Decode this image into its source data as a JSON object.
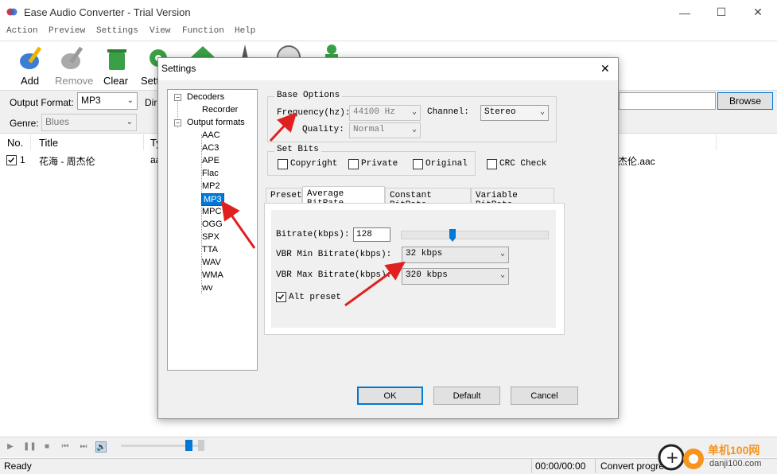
{
  "window": {
    "title": "Ease Audio Converter - Trial Version",
    "minimize": "—",
    "maximize": "☐",
    "close": "✕"
  },
  "menu": [
    "Action",
    "Preview",
    "Settings",
    "View",
    "Function",
    "Help"
  ],
  "toolbar": {
    "add": "Add",
    "remove": "Remove",
    "clear": "Clear",
    "settings": "Sett"
  },
  "format_row": {
    "output_format_label": "Output Format:",
    "output_format_value": "MP3",
    "dir_label": "Dire",
    "browse": "Browse",
    "genre_label": "Genre:",
    "genre_value": "Blues"
  },
  "list": {
    "headers": [
      "No.",
      "Title",
      "Ty"
    ],
    "rows": [
      {
        "no": "1",
        "title": "花海 - 周杰伦",
        "type": "aa",
        "path_tail": "杰伦.aac",
        "checked": true
      }
    ]
  },
  "status": {
    "ready": "Ready",
    "time": "00:00/00:00",
    "convert": "Convert progres"
  },
  "watermark": {
    "text": "单机100网",
    "url": "danji100.com"
  },
  "dialog": {
    "title": "Settings",
    "close": "✕",
    "tree": {
      "decoders": "Decoders",
      "recorder": "Recorder",
      "output_formats": "Output formats",
      "formats": [
        "AAC",
        "AC3",
        "APE",
        "Flac",
        "MP2",
        "MP3",
        "MPC",
        "OGG",
        "SPX",
        "TTA",
        "WAV",
        "WMA",
        "wv"
      ],
      "selected": "MP3",
      "expander": "−"
    },
    "base_options": {
      "label": "Base Options",
      "frequency_label": "Frequency(hz):",
      "frequency_value": "44100 Hz",
      "channel_label": "Channel:",
      "channel_value": "Stereo",
      "quality_label": "Quality:",
      "quality_value": "Normal"
    },
    "set_bits": {
      "label": "Set Bits",
      "copyright": "Copyright",
      "private": "Private",
      "original": "Original",
      "crc": "CRC Check"
    },
    "tabs": [
      "Preset",
      "Average BitRate",
      "Constant BitRate",
      "Variable BitRate"
    ],
    "active_tab": "Average BitRate",
    "abr": {
      "bitrate_label": "Bitrate(kbps):",
      "bitrate_value": "128",
      "slider_fraction": 0.35,
      "vbr_min_label": "VBR Min Bitrate(kbps):",
      "vbr_min_value": "32 kbps",
      "vbr_max_label": "VBR Max Bitrate(kbps):",
      "vbr_max_value": "320 kbps",
      "alt_preset_label": "Alt preset",
      "alt_preset_checked": true
    },
    "buttons": {
      "ok": "OK",
      "default": "Default",
      "cancel": "Cancel"
    }
  },
  "colors": {
    "accent": "#0078d7",
    "annotation_arrow": "#e02020",
    "selection": "#0078d7"
  }
}
